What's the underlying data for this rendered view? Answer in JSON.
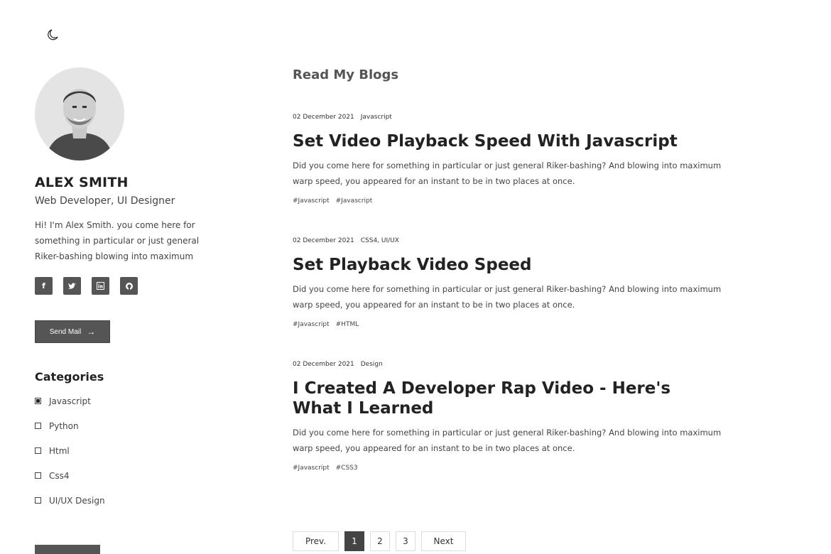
{
  "sidebar": {
    "name": "ALEX SMITH",
    "role": "Web Developer, UI Designer",
    "bio": "Hi! I'm Alex Smith. you come here for something in particular or just general Riker-bashing blowing into maximum",
    "social": [
      {
        "icon": "facebook-icon",
        "glyph": "f"
      },
      {
        "icon": "twitter-icon",
        "glyph": "t"
      },
      {
        "icon": "linkedin-icon",
        "glyph": "in"
      },
      {
        "icon": "github-icon",
        "glyph": "gh"
      }
    ],
    "send_mail_label": "Send Mail",
    "send_mail_arrow": "→",
    "categories_title": "Categories",
    "categories": [
      {
        "label": "Javascript",
        "checked": true
      },
      {
        "label": "Python",
        "checked": false
      },
      {
        "label": "Html",
        "checked": false
      },
      {
        "label": "Css4",
        "checked": false
      },
      {
        "label": "UI/UX Design",
        "checked": false
      }
    ]
  },
  "main": {
    "title": "Read My Blogs",
    "posts": [
      {
        "date": "02 December 2021",
        "category": "Javascript",
        "title": "Set Video Playback Speed With Javascript",
        "body": "Did you come here for something in particular or just general Riker-bashing? And blowing into maximum warp speed, you appeared for an instant to be in two places at once.",
        "tags": [
          "#Javascript",
          "#Javascript"
        ]
      },
      {
        "date": "02 December 2021",
        "category": "CSS4, UI/UX",
        "title": "Set Playback Video Speed",
        "body": "Did you come here for something in particular or just general Riker-bashing? And blowing into maximum warp speed, you appeared for an instant to be in two places at once.",
        "tags": [
          "#Javascript",
          "#HTML"
        ]
      },
      {
        "date": "02 December 2021",
        "category": "Design",
        "title": "I Created A Developer Rap Video - Here's What I Learned",
        "body": "Did you come here for something in particular or just general Riker-bashing? And blowing into maximum warp speed, you appeared for an instant to be in two places at once.",
        "tags": [
          "#Javascript",
          "#CSS3"
        ]
      }
    ]
  },
  "pagination": {
    "prev": "Prev.",
    "pages": [
      "1",
      "2",
      "3"
    ],
    "active": "1",
    "next": "Next"
  }
}
